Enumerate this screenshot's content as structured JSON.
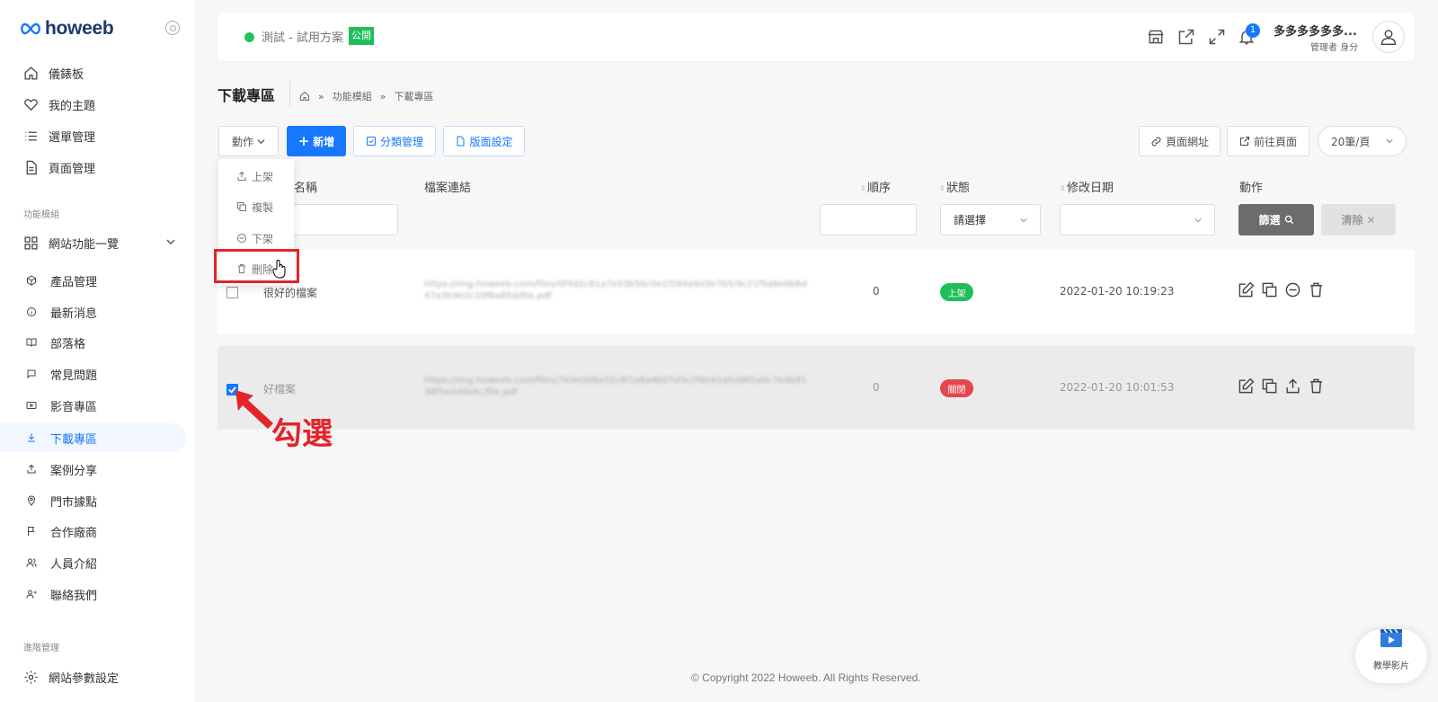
{
  "brand": {
    "name": "howeeb"
  },
  "sidebar": {
    "items": [
      {
        "label": "儀錶板",
        "icon": "home-icon"
      },
      {
        "label": "我的主題",
        "icon": "heart-icon"
      },
      {
        "label": "選單管理",
        "icon": "list-icon"
      },
      {
        "label": "頁面管理",
        "icon": "file-icon"
      }
    ],
    "section_modules": "功能模組",
    "site_features": "網站功能一覽",
    "module_items": [
      {
        "label": "產品管理",
        "icon": "box-icon"
      },
      {
        "label": "最新消息",
        "icon": "info-icon"
      },
      {
        "label": "部落格",
        "icon": "book-icon"
      },
      {
        "label": "常見問題",
        "icon": "chat-icon"
      },
      {
        "label": "影音專區",
        "icon": "video-icon"
      },
      {
        "label": "下載專區",
        "icon": "download-icon"
      },
      {
        "label": "案例分享",
        "icon": "share-icon"
      },
      {
        "label": "門市據點",
        "icon": "pin-icon"
      },
      {
        "label": "合作廠商",
        "icon": "flag-icon"
      },
      {
        "label": "人員介紹",
        "icon": "users-icon"
      },
      {
        "label": "聯絡我們",
        "icon": "contact-icon"
      }
    ],
    "section_advanced": "進階管理",
    "settings": "網站參數設定"
  },
  "header": {
    "site_name": "測試 - 試用方案",
    "public_badge": "公開",
    "notification_count": "1",
    "user_name": "多多多多多多...",
    "user_role": "管理者 身分"
  },
  "page": {
    "title": "下載專區",
    "breadcrumb": [
      "功能模組",
      "下載專區"
    ]
  },
  "toolbar": {
    "action_label": "動作",
    "add_label": "新增",
    "category_label": "分類管理",
    "layout_label": "版面設定",
    "page_url_label": "頁面網址",
    "goto_page_label": "前往頁面",
    "per_page": "20筆/頁"
  },
  "dropdown": {
    "items": [
      {
        "label": "上架",
        "icon": "upload-icon"
      },
      {
        "label": "複製",
        "icon": "copy-icon"
      },
      {
        "label": "下架",
        "icon": "minus-circle-icon"
      },
      {
        "label": "刪除",
        "icon": "trash-icon"
      }
    ]
  },
  "table": {
    "headers": {
      "name": "名稱",
      "link": "檔案連結",
      "order": "順序",
      "status": "狀態",
      "modified": "修改日期",
      "actions": "動作"
    },
    "status_placeholder": "請選擇",
    "filter_label": "篩選",
    "clear_label": "清除",
    "rows": [
      {
        "name": "很好的檔案",
        "link": "https://img.howeeb.com/files/0f4d2c81a7e93b56c0e1f284a9d3e7b5/9c21f5a8e0b6d47a3b9e2c10f6a85d/file.pdf",
        "order": "0",
        "status": "上架",
        "status_color": "#1fbe5b",
        "modified": "2022-01-20 10:19:23"
      },
      {
        "name": "好檔案",
        "link": "https://img.howeeb.com/files/7b3e0d9a52c8f1e6a4b07d3c2f8e91a5/d6f2a0c7e4b9138f5a2d0e6c/file.pdf",
        "order": "0",
        "status": "關閉",
        "status_color": "#e5474d",
        "modified": "2022-01-20 10:01:53"
      }
    ]
  },
  "annotation": {
    "text": "勾選"
  },
  "footer": {
    "copyright": "© Copyright 2022 Howeeb. All Rights Reserved.",
    "tutorial": "教學影片"
  }
}
